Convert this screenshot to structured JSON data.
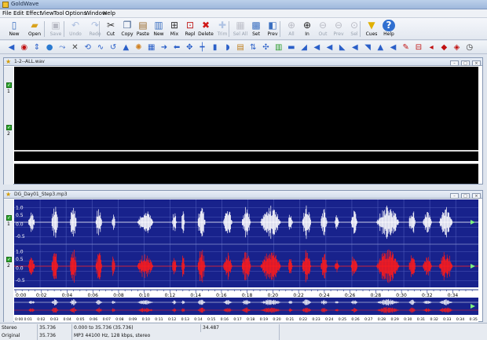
{
  "window": {
    "title": "GoldWave"
  },
  "menu": [
    "File",
    "Edit",
    "Effect",
    "View",
    "Tool",
    "Options",
    "Window",
    "Help"
  ],
  "toolbar": [
    {
      "name": "new-button",
      "label": "New",
      "icon": "new-file-icon",
      "glyph": "▯",
      "color": "#3a6fc0",
      "enabled": true
    },
    {
      "name": "open-button",
      "label": "Open",
      "icon": "folder-open-icon",
      "glyph": "▰",
      "color": "#d9a21c",
      "enabled": true
    },
    {
      "name": "save-button",
      "label": "Save",
      "icon": "save-icon",
      "glyph": "▣",
      "color": "#556",
      "enabled": false
    },
    {
      "name": "undo-button",
      "label": "Undo",
      "icon": "undo-icon",
      "glyph": "↶",
      "color": "#2c5fb3",
      "enabled": false
    },
    {
      "name": "redo-button",
      "label": "Redo",
      "icon": "redo-icon",
      "glyph": "↷",
      "color": "#2c5fb3",
      "enabled": false
    },
    {
      "name": "cut-button",
      "label": "Cut",
      "icon": "scissors-icon",
      "glyph": "✂",
      "color": "#333",
      "enabled": true
    },
    {
      "name": "copy-button",
      "label": "Copy",
      "icon": "copy-icon",
      "glyph": "❐",
      "color": "#3a5a8a",
      "enabled": true
    },
    {
      "name": "paste-button",
      "label": "Paste",
      "icon": "paste-icon",
      "glyph": "▤",
      "color": "#9a6a2a",
      "enabled": true
    },
    {
      "name": "paste-new-button",
      "label": "New",
      "icon": "paste-new-icon",
      "glyph": "▥",
      "color": "#3a6fc0",
      "enabled": true
    },
    {
      "name": "mix-button",
      "label": "Mix",
      "icon": "mix-icon",
      "glyph": "⊞",
      "color": "#333",
      "enabled": true
    },
    {
      "name": "replace-button",
      "label": "Repl",
      "icon": "replace-icon",
      "glyph": "⊡",
      "color": "#c02020",
      "enabled": true
    },
    {
      "name": "delete-button",
      "label": "Delete",
      "icon": "delete-x-icon",
      "glyph": "✖",
      "color": "#d01818",
      "enabled": true
    },
    {
      "name": "trim-button",
      "label": "Trim",
      "icon": "trim-icon",
      "glyph": "✚",
      "color": "#3a6fc0",
      "enabled": false
    },
    {
      "name": "select-all-button",
      "label": "Sel All",
      "icon": "select-all-icon",
      "glyph": "▦",
      "color": "#667",
      "enabled": false
    },
    {
      "name": "set-button",
      "label": "Set",
      "icon": "set-selection-icon",
      "glyph": "▩",
      "color": "#3a6fc0",
      "enabled": true
    },
    {
      "name": "prev-button",
      "label": "Prev",
      "icon": "previous-icon",
      "glyph": "◧",
      "color": "#3a6fc0",
      "enabled": true
    },
    {
      "name": "zoom-all-button",
      "label": "All",
      "icon": "zoom-all-icon",
      "glyph": "⊕",
      "color": "#556",
      "enabled": false
    },
    {
      "name": "zoom-in-button",
      "label": "In",
      "icon": "zoom-in-icon",
      "glyph": "⊕",
      "color": "#222",
      "enabled": true
    },
    {
      "name": "zoom-out-button",
      "label": "Out",
      "icon": "zoom-out-icon",
      "glyph": "⊖",
      "color": "#556",
      "enabled": false
    },
    {
      "name": "zoom-previous-button",
      "label": "Prev",
      "icon": "zoom-previous-icon",
      "glyph": "⊖",
      "color": "#556",
      "enabled": false
    },
    {
      "name": "zoom-selection-button",
      "label": "Sel",
      "icon": "zoom-selection-icon",
      "glyph": "⊙",
      "color": "#556",
      "enabled": false
    },
    {
      "name": "cues-button",
      "label": "Cues",
      "icon": "cues-triangle-icon",
      "glyph": "▼",
      "color": "#e0b000",
      "enabled": true
    },
    {
      "name": "help-button",
      "label": "Help",
      "icon": "help-icon",
      "glyph": "?",
      "color": "#fff",
      "enabled": true
    }
  ],
  "effects_toolbar": [
    {
      "name": "effect-fade-in-icon",
      "glyph": "◀",
      "color": "#2a5fc8"
    },
    {
      "name": "effect-noise-icon",
      "glyph": "◉",
      "color": "#c01010"
    },
    {
      "name": "effect-resize-icon",
      "glyph": "⇕",
      "color": "#2a5fc8"
    },
    {
      "name": "effect-globe-icon",
      "glyph": "●",
      "color": "#2a7ad0"
    },
    {
      "name": "effect-fade-out-icon",
      "glyph": "⤳",
      "color": "#2a5fc8"
    },
    {
      "name": "effect-crossfade-icon",
      "glyph": "✕",
      "color": "#444"
    },
    {
      "name": "effect-echo-icon",
      "glyph": "⟲",
      "color": "#2a5fc8"
    },
    {
      "name": "effect-flanger-icon",
      "glyph": "∿",
      "color": "#2a5fc8"
    },
    {
      "name": "effect-reverse-icon",
      "glyph": "↺",
      "color": "#2a5fc8"
    },
    {
      "name": "effect-filter-icon",
      "glyph": "▲",
      "color": "#2a5fc8"
    },
    {
      "name": "effect-doppler-icon",
      "glyph": "✺",
      "color": "#d08020"
    },
    {
      "name": "effect-graph-icon",
      "glyph": "▦",
      "color": "#2a5fc8"
    },
    {
      "name": "effect-forward-icon",
      "glyph": "➜",
      "color": "#2a5fc8"
    },
    {
      "name": "effect-back-icon",
      "glyph": "⬅",
      "color": "#2a5fc8"
    },
    {
      "name": "effect-balance-icon",
      "glyph": "✥",
      "color": "#2a5fc8"
    },
    {
      "name": "effect-eq-icon",
      "glyph": "┿",
      "color": "#2a5fc8"
    },
    {
      "name": "effect-bars-icon",
      "glyph": "▮",
      "color": "#2a5fc8"
    },
    {
      "name": "effect-dome-icon",
      "glyph": "◗",
      "color": "#2a5fc8"
    },
    {
      "name": "effect-meter-icon",
      "glyph": "▤",
      "color": "#c08020"
    },
    {
      "name": "effect-pitch-icon",
      "glyph": "⇅",
      "color": "#2a5fc8"
    },
    {
      "name": "effect-resample-icon",
      "glyph": "✣",
      "color": "#2a5fc8"
    },
    {
      "name": "effect-chart-icon",
      "glyph": "▥",
      "color": "#2a9a2a"
    },
    {
      "name": "effect-offset-icon",
      "glyph": "▬",
      "color": "#2a5fc8"
    },
    {
      "name": "effect-volume-shape-icon",
      "glyph": "◢",
      "color": "#2a5fc8"
    },
    {
      "name": "effect-speaker-icon",
      "glyph": "◀",
      "color": "#2a5fc8"
    },
    {
      "name": "effect-speaker-low-icon",
      "glyph": "◀",
      "color": "#2a5fc8"
    },
    {
      "name": "effect-ramp-icon",
      "glyph": "◣",
      "color": "#2a5fc8"
    },
    {
      "name": "effect-speaker-mute-icon",
      "glyph": "◀",
      "color": "#2a5fc8"
    },
    {
      "name": "effect-match-icon",
      "glyph": "◥",
      "color": "#2a5fc8"
    },
    {
      "name": "effect-marker-icon",
      "glyph": "▲",
      "color": "#2a5fc8"
    },
    {
      "name": "effect-volume-icon",
      "glyph": "◀",
      "color": "#2a5fc8"
    },
    {
      "name": "effect-pen-icon",
      "glyph": "✎",
      "color": "#c01010"
    },
    {
      "name": "effect-mixer-icon",
      "glyph": "⊟",
      "color": "#c01010"
    },
    {
      "name": "effect-mono-icon",
      "glyph": "◂",
      "color": "#c01010"
    },
    {
      "name": "effect-stereo-icon",
      "glyph": "◆",
      "color": "#c01010"
    },
    {
      "name": "effect-mute-icon",
      "glyph": "◈",
      "color": "#c01010"
    },
    {
      "name": "effect-clock-icon",
      "glyph": "◷",
      "color": "#333"
    }
  ],
  "panels": [
    {
      "title": "1-2--ALL.wav"
    },
    {
      "title": "DG_Day01_Step3.mp3"
    }
  ],
  "wave_axis": {
    "y_top_labels": [
      "1.0",
      "0.5",
      "0.0",
      "-0.5"
    ],
    "y_bottom_labels": [
      "1.0",
      "0.5",
      "0.0",
      "-0.5"
    ]
  },
  "timeline": [
    "0:00",
    "0:02",
    "0:04",
    "0:06",
    "0:08",
    "0:10",
    "0:12",
    "0:14",
    "0:16",
    "0:18",
    "0:20",
    "0:22",
    "0:24",
    "0:26",
    "0:28",
    "0:30",
    "0:32",
    "0:34"
  ],
  "overview_timeline": [
    "0:00",
    "0:01",
    "0:02",
    "0:03",
    "0:04",
    "0:05",
    "0:06",
    "0:07",
    "0:08",
    "0:09",
    "0:10",
    "0:11",
    "0:12",
    "0:13",
    "0:14",
    "0:15",
    "0:16",
    "0:17",
    "0:18",
    "0:19",
    "0:20",
    "0:21",
    "0:22",
    "0:23",
    "0:24",
    "0:25",
    "0:26",
    "0:27",
    "0:28",
    "0:29",
    "0:30",
    "0:31",
    "0:32",
    "0:33",
    "0:34",
    "0:35"
  ],
  "status": {
    "channels": "Stereo",
    "length": "35.736",
    "selection": "0.000 to 35.736 (35.736)",
    "position": "34.487",
    "mode": "Original",
    "total": "35.736",
    "format": "MP3 44100 Hz, 128 kbps, stereo"
  },
  "colors": {
    "wave_bg": "#18228c",
    "top_channel": "#ffffff",
    "bottom_channel": "#ff1a1a",
    "grid": "#4c58b8",
    "play_marker": "#7cf07c"
  }
}
